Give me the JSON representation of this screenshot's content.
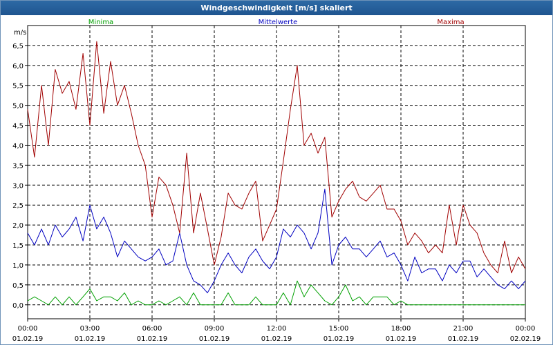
{
  "window": {
    "title": "Windgeschwindigkeit [m/s] skaliert"
  },
  "chart_data": {
    "type": "line",
    "ylabel": "m/s",
    "ylim": [
      -0.35,
      7.0
    ],
    "xlim_hours": [
      0,
      24
    ],
    "y_ticks": [
      "0,0",
      "0,5",
      "1,0",
      "1,5",
      "2,0",
      "2,5",
      "3,0",
      "3,5",
      "4,0",
      "4,5",
      "5,0",
      "5,5",
      "6,0",
      "6,5"
    ],
    "y_tick_values": [
      0,
      0.5,
      1,
      1.5,
      2,
      2.5,
      3,
      3.5,
      4,
      4.5,
      5,
      5.5,
      6,
      6.5
    ],
    "x_ticks": [
      {
        "time": "00:00",
        "date": "01.02.19",
        "hour": 0
      },
      {
        "time": "03:00",
        "date": "01.02.19",
        "hour": 3
      },
      {
        "time": "06:00",
        "date": "01.02.19",
        "hour": 6
      },
      {
        "time": "09:00",
        "date": "01.02.19",
        "hour": 9
      },
      {
        "time": "12:00",
        "date": "01.02.19",
        "hour": 12
      },
      {
        "time": "15:00",
        "date": "01.02.19",
        "hour": 15
      },
      {
        "time": "18:00",
        "date": "01.02.19",
        "hour": 18
      },
      {
        "time": "21:00",
        "date": "01.02.19",
        "hour": 21
      },
      {
        "time": "00:00",
        "date": "02.02.19",
        "hour": 24
      }
    ],
    "grid": true,
    "legend_position": "top",
    "series": [
      {
        "name": "Minima",
        "color": "#00a000",
        "hours": [
          0,
          0.33,
          0.67,
          1,
          1.33,
          1.67,
          2,
          2.33,
          2.67,
          3,
          3.33,
          3.67,
          4,
          4.33,
          4.67,
          5,
          5.33,
          5.67,
          6,
          6.33,
          6.67,
          7,
          7.33,
          7.67,
          8,
          8.33,
          8.67,
          9,
          9.33,
          9.67,
          10,
          10.33,
          10.67,
          11,
          11.33,
          11.67,
          12,
          12.33,
          12.67,
          13,
          13.33,
          13.67,
          14,
          14.33,
          14.67,
          15,
          15.33,
          15.67,
          16,
          16.33,
          16.67,
          17,
          17.33,
          17.67,
          18,
          18.33,
          18.67,
          19,
          19.33,
          19.67,
          20,
          20.33,
          20.67,
          21,
          21.33,
          21.67,
          22,
          22.33,
          22.67,
          23,
          23.33,
          23.67,
          24
        ],
        "values": [
          0.1,
          0.2,
          0.1,
          0.0,
          0.2,
          0.0,
          0.2,
          0.0,
          0.2,
          0.4,
          0.1,
          0.2,
          0.2,
          0.1,
          0.3,
          0.0,
          0.1,
          0.0,
          0.0,
          0.1,
          0.0,
          0.1,
          0.2,
          0.0,
          0.3,
          0.0,
          0.0,
          0.0,
          0.0,
          0.3,
          0.0,
          0.0,
          0.0,
          0.2,
          0.0,
          0.0,
          0.0,
          0.3,
          0.0,
          0.6,
          0.2,
          0.5,
          0.3,
          0.1,
          0.0,
          0.2,
          0.5,
          0.1,
          0.2,
          0.0,
          0.2,
          0.2,
          0.2,
          0.0,
          0.1,
          0.0,
          0.0,
          0.0,
          0.0,
          0.0,
          0.0,
          0.0,
          0.0,
          0.0,
          0.0,
          0.0,
          0.0,
          0.0,
          0.0,
          0.0,
          0.0,
          0.0,
          0.0
        ]
      },
      {
        "name": "Mittelwerte",
        "color": "#0000c0",
        "hours": [
          0,
          0.33,
          0.67,
          1,
          1.33,
          1.67,
          2,
          2.33,
          2.67,
          3,
          3.33,
          3.67,
          4,
          4.33,
          4.67,
          5,
          5.33,
          5.67,
          6,
          6.33,
          6.67,
          7,
          7.33,
          7.67,
          8,
          8.33,
          8.67,
          9,
          9.33,
          9.67,
          10,
          10.33,
          10.67,
          11,
          11.33,
          11.67,
          12,
          12.33,
          12.67,
          13,
          13.33,
          13.67,
          14,
          14.33,
          14.67,
          15,
          15.33,
          15.67,
          16,
          16.33,
          16.67,
          17,
          17.33,
          17.67,
          18,
          18.33,
          18.67,
          19,
          19.33,
          19.67,
          20,
          20.33,
          20.67,
          21,
          21.33,
          21.67,
          22,
          22.33,
          22.67,
          23,
          23.33,
          23.67,
          24
        ],
        "values": [
          1.8,
          1.5,
          1.9,
          1.5,
          2.0,
          1.7,
          1.9,
          2.2,
          1.6,
          2.5,
          1.9,
          2.2,
          1.8,
          1.2,
          1.6,
          1.4,
          1.2,
          1.1,
          1.2,
          1.4,
          1.0,
          1.1,
          1.8,
          1.0,
          0.6,
          0.5,
          0.3,
          0.6,
          1.0,
          1.3,
          1.0,
          0.8,
          1.2,
          1.4,
          1.1,
          0.9,
          1.2,
          1.9,
          1.7,
          2.0,
          1.8,
          1.4,
          1.8,
          2.9,
          1.0,
          1.5,
          1.7,
          1.4,
          1.4,
          1.2,
          1.4,
          1.6,
          1.2,
          1.3,
          1.0,
          0.6,
          1.2,
          0.8,
          0.9,
          0.9,
          0.6,
          1.0,
          0.8,
          1.1,
          1.1,
          0.7,
          0.9,
          0.7,
          0.5,
          0.4,
          0.6,
          0.4,
          0.6
        ]
      },
      {
        "name": "Maxima",
        "color": "#a00000",
        "hours": [
          0,
          0.33,
          0.67,
          1,
          1.33,
          1.67,
          2,
          2.33,
          2.67,
          3,
          3.33,
          3.67,
          4,
          4.33,
          4.67,
          5,
          5.33,
          5.67,
          6,
          6.33,
          6.67,
          7,
          7.33,
          7.67,
          8,
          8.33,
          8.67,
          9,
          9.33,
          9.67,
          10,
          10.33,
          10.67,
          11,
          11.33,
          11.67,
          12,
          12.33,
          12.67,
          13,
          13.33,
          13.67,
          14,
          14.33,
          14.67,
          15,
          15.33,
          15.67,
          16,
          16.33,
          16.67,
          17,
          17.33,
          17.67,
          18,
          18.33,
          18.67,
          19,
          19.33,
          19.67,
          20,
          20.33,
          20.67,
          21,
          21.33,
          21.67,
          22,
          22.33,
          22.67,
          23,
          23.33,
          23.67,
          24
        ],
        "values": [
          4.9,
          3.7,
          5.5,
          4.0,
          5.9,
          5.3,
          5.6,
          4.9,
          6.3,
          4.5,
          6.6,
          4.8,
          6.1,
          5.0,
          5.5,
          4.8,
          4.0,
          3.5,
          2.2,
          3.2,
          3.0,
          2.5,
          1.8,
          3.8,
          1.8,
          2.8,
          1.9,
          1.0,
          1.7,
          2.8,
          2.5,
          2.4,
          2.8,
          3.1,
          1.6,
          2.0,
          2.4,
          3.6,
          4.9,
          6.0,
          4.0,
          4.3,
          3.8,
          4.2,
          2.2,
          2.6,
          2.9,
          3.1,
          2.7,
          2.6,
          2.8,
          3.0,
          2.4,
          2.4,
          2.1,
          1.5,
          1.8,
          1.6,
          1.3,
          1.5,
          1.3,
          2.5,
          1.5,
          2.5,
          2.0,
          1.8,
          1.3,
          1.0,
          0.8,
          1.6,
          0.8,
          1.2,
          0.9
        ]
      }
    ]
  }
}
